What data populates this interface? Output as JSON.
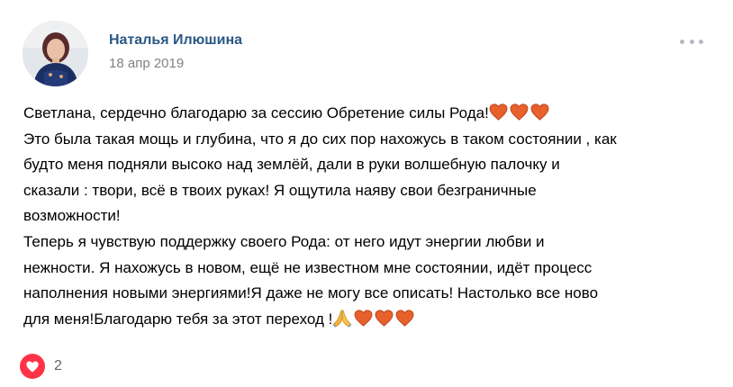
{
  "post": {
    "author_name": "Наталья Илюшина",
    "date": "18 апр 2019",
    "text_lines": [
      "Светлана, сердечно благодарю за сессию Обретение силы Рода!",
      "Это была такая мощь и глубина, что я до сих пор нахожусь в таком состоянии , как",
      "будто меня подняли высоко над землёй, дали в руки волшебную палочку и",
      "сказали : твори, всё в твоих руках! Я ощутила наяву свои безграничные",
      "возможности!",
      "Теперь я чувствую поддержку своего Рода: от него идут энергии любви и",
      "нежности. Я нахожусь в новом, ещё не известном мне состоянии, идёт процесс",
      "наполнения новыми энергиями!Я даже не могу все описать! Настолько все ново",
      "для меня!Благодарю тебя за этот переход !"
    ],
    "emojis": {
      "line_1": [
        "orange-heart",
        "orange-heart",
        "orange-heart"
      ],
      "line_9": [
        "folded-hands",
        "orange-heart",
        "orange-heart",
        "orange-heart"
      ]
    },
    "likes": {
      "count": "2",
      "icon": "heart-icon",
      "color": "#ff3347"
    }
  },
  "colors": {
    "author_link": "#2a5885",
    "date_text": "#828282",
    "heart_emoji": "#e8602c",
    "more_dots": "#b4bac1"
  }
}
